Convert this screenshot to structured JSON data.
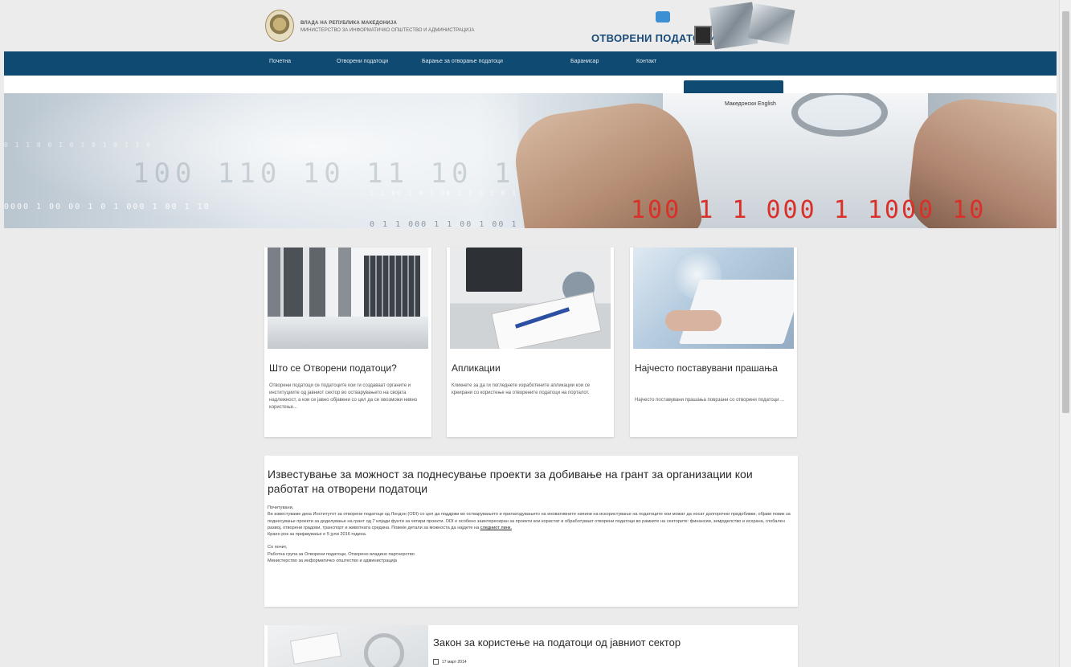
{
  "header": {
    "gov_line1": "ВЛАДА НА РЕПУБЛИКА МАКЕДОНИЈА",
    "gov_line2": "МИНИСТЕРСТВО ЗА ИНФОРМАТИЧКО ОПШТЕСТВО И АДМИНИСТРАЦИЈА",
    "portal_title": "ОТВОРЕНИ ПОДАТОЦИ"
  },
  "nav": {
    "items": [
      {
        "label": "Почетна"
      },
      {
        "label": "Отворени податоци"
      },
      {
        "label": "Барање за отворање податоци"
      },
      {
        "label": "Бараниcap"
      },
      {
        "label": "Контакт"
      }
    ]
  },
  "lang": {
    "label": "Македонски  English"
  },
  "hero": {
    "binary_big": "100 110 10 11   10 10 10 10   10",
    "binary_s1": "0000 1 00 00 1 0 1 000 1 00 1 10",
    "binary_s2": "0 1 1 000 1 1 00 1 00 1 10",
    "binary_s3": "1 1 00 1 0 1 00 1 1 0 1 0 1 00 0000 1 00",
    "binary_s4": "0 1 1 0 0 1 0 1 0 1 0 1 1 0",
    "binary_red": "100 1 1 000 1 1000 10"
  },
  "cards": [
    {
      "title": "Што се Отворени податоци?",
      "text": "Отворени податоци се податоците кои ги создаваат органите и институциите од јавниот сектор во остварувањето на својата надлежност, а кои се јавно објавени со цел да се овозможи нивно користење..."
    },
    {
      "title": "Апликации",
      "text": "Кликнете за да ги погледнете изработените апликации кои се креирани со користење на отворените податоци на порталот."
    },
    {
      "title": "Најчесто поставувани прашања",
      "text": "Најчесто поставувани прашања поврзани со отворени податоци ..."
    }
  ],
  "announcement": {
    "title": "Известување за можност за поднесување проекти за добивање на грант за организации кои работат на отворени податоци",
    "greeting": "Почитувани,",
    "body": "Ве известуваме дека Институтот за отворени податоци од Лондон (ODI) со цел да поддржи во остварувањето и прилагодувањето на иновативните начини на искористување на податоците кои можат да носат долгорочни придобивки, објави повик за поднесување проекти за доделување на грант од 7 илјади фунти за четири проекти. ODI е особено заинтересиран за проекти кои користат и обработуваат отворени податоци во рамките на секторите: финансии, земјоделство и исхрана, глобален развој, отворени градови, транспорт и животната средина. Повеќе детали за можноста да најдете на",
    "link": "следниот линк.",
    "deadline": "Краен рок за пријавување е 5 јули 2016 година.",
    "sign1": "Со почит,",
    "sign2": "Работна група за Отворени податоци, Отворено владино партнерство",
    "sign3": "Министерство за информатичко општество и администрација"
  },
  "law": {
    "title": "Закон за користење на податоци од јавниот сектор",
    "date": "17 март 2014"
  }
}
